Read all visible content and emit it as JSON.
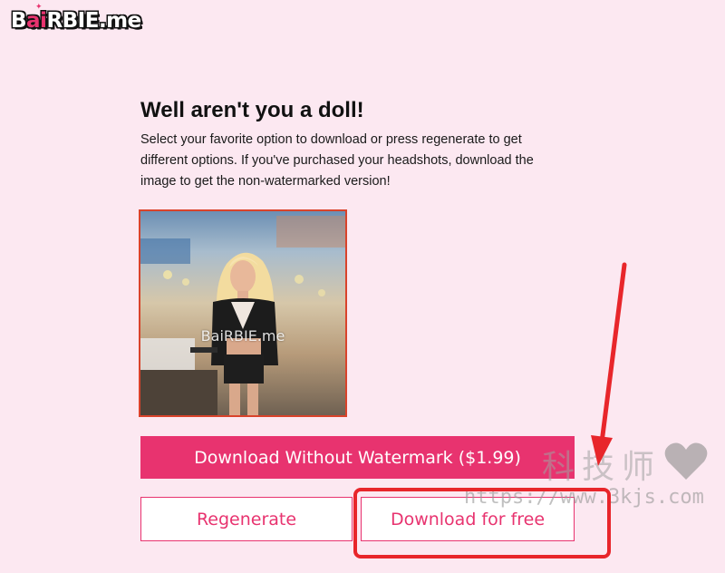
{
  "header": {
    "logo_b": "B",
    "logo_ai": "ai",
    "logo_rest": "RBIE.me"
  },
  "main": {
    "headline": "Well aren't you a doll!",
    "description": "Select your favorite option to download or press regenerate to get different options. If you've purchased your headshots, download the image to get the non-watermarked version!",
    "image_watermark": "BaiRBIE.me",
    "download_paid_label": "Download Without Watermark ($1.99)",
    "regenerate_label": "Regenerate",
    "download_free_label": "Download for free"
  },
  "overlay": {
    "site_watermark_cn": "科技师",
    "site_watermark_url": "https://www.3kjs.com",
    "annotation_color": "#e8262b"
  },
  "colors": {
    "background": "#fce8f1",
    "accent": "#e8336f"
  }
}
